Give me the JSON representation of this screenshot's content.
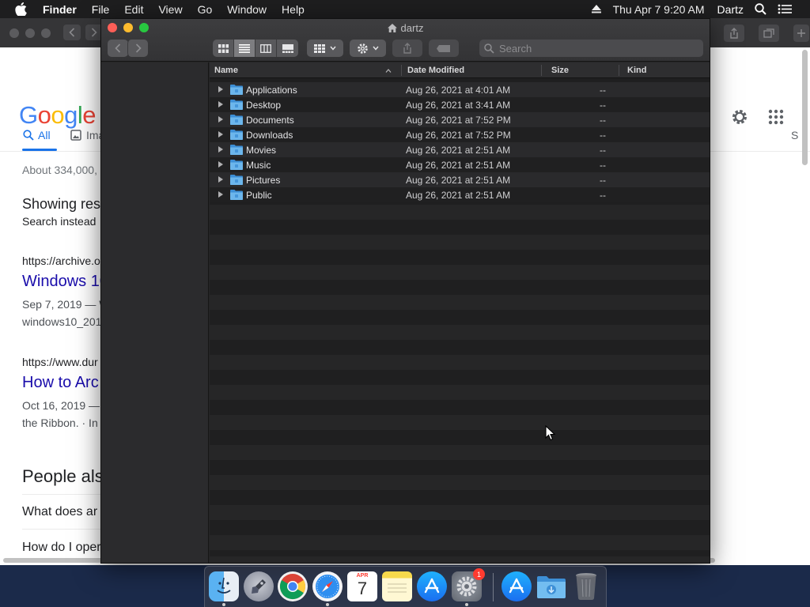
{
  "menubar": {
    "app_name": "Finder",
    "items": [
      "File",
      "Edit",
      "View",
      "Go",
      "Window",
      "Help"
    ],
    "clock": "Thu Apr 7  9:20 AM",
    "user": "Dartz",
    "icons": [
      "apple-icon",
      "eject-icon",
      "spotlight-icon",
      "control-center-icon"
    ]
  },
  "browser": {
    "logo_letters": [
      "G",
      "o",
      "o",
      "g",
      "l",
      "e"
    ],
    "logo_colors": [
      "#4285f4",
      "#ea4335",
      "#fbbc05",
      "#4285f4",
      "#34a853",
      "#ea4335"
    ],
    "tab_all": "All",
    "tab_images": "Ima",
    "tab_right": "S",
    "stats": "About 334,000,",
    "showing": "Showing res",
    "search_instead": "Search instead",
    "result1": {
      "url": "https://archive.o",
      "title": "Windows 10",
      "date": "Sep 7, 2019 — W",
      "snippet": "windows10_201"
    },
    "result2": {
      "url": "https://www.dur",
      "title": "How to Arc",
      "date": "Oct 16, 2019 —",
      "snippet": "the Ribbon. · In"
    },
    "people_also": "People als",
    "questions": [
      "What does ar",
      "How do I oper"
    ]
  },
  "finder": {
    "title": "dartz",
    "search_placeholder": "Search",
    "columns": {
      "name": "Name",
      "date": "Date Modified",
      "size": "Size",
      "kind": "Kind"
    },
    "rows": [
      {
        "name": "Applications",
        "date": "Aug 26, 2021 at 4:01 AM",
        "size": "--"
      },
      {
        "name": "Desktop",
        "date": "Aug 26, 2021 at 3:41 AM",
        "size": "--"
      },
      {
        "name": "Documents",
        "date": "Aug 26, 2021 at 7:52 PM",
        "size": "--"
      },
      {
        "name": "Downloads",
        "date": "Aug 26, 2021 at 7:52 PM",
        "size": "--"
      },
      {
        "name": "Movies",
        "date": "Aug 26, 2021 at 2:51 AM",
        "size": "--"
      },
      {
        "name": "Music",
        "date": "Aug 26, 2021 at 2:51 AM",
        "size": "--"
      },
      {
        "name": "Pictures",
        "date": "Aug 26, 2021 at 2:51 AM",
        "size": "--"
      },
      {
        "name": "Public",
        "date": "Aug 26, 2021 at 2:51 AM",
        "size": "--"
      }
    ]
  },
  "dock": {
    "apps": [
      "finder-icon",
      "launchpad-icon",
      "chrome-icon",
      "safari-icon",
      "calendar-icon",
      "notes-icon",
      "app-store-icon",
      "system-preferences-icon",
      "app-store-icon",
      "downloads-folder-icon",
      "trash-icon"
    ],
    "calendar_month": "APR",
    "calendar_day": "7",
    "prefs_badge": "1"
  }
}
